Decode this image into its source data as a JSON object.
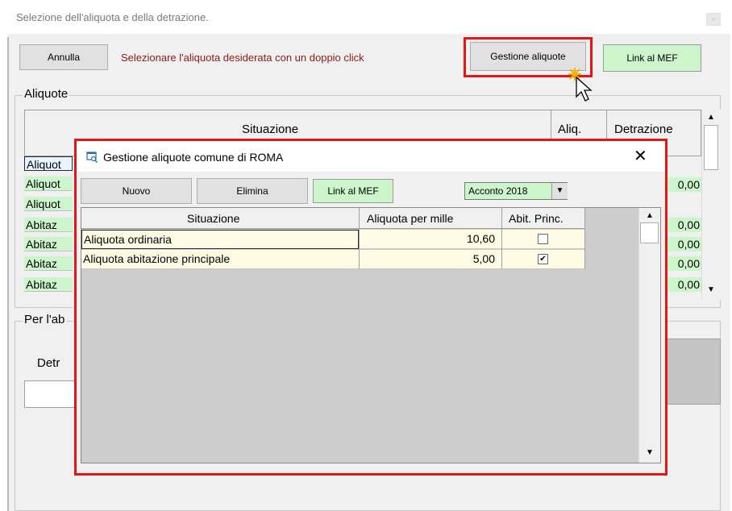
{
  "window": {
    "title": "Selezione dell'aliquota e della detrazione.",
    "close_symbol": "×"
  },
  "toolbar": {
    "annulla_label": "Annulla",
    "instruction": "Selezionare l'aliquota desiderata con un doppio click",
    "gestione_label": "Gestione aliquote",
    "link_mef_label": "Link al MEF"
  },
  "aliquote_section": {
    "label": "Aliquote",
    "columns": [
      "Situazione",
      "Aliq.",
      "Detrazione"
    ],
    "row_labels": [
      "Aliquot",
      "Aliquot",
      "Aliquot",
      "Abitaz",
      "Abitaz",
      "Abitaz",
      "Abitaz"
    ],
    "right_values": [
      "0,00",
      "0,00",
      "0,00",
      "0,00",
      "0,00"
    ]
  },
  "per_section": {
    "label": "Per l'ab",
    "detr_label": "Detr"
  },
  "dialog": {
    "title": "Gestione aliquote comune di ROMA",
    "close_symbol": "✕",
    "buttons": {
      "nuovo": "Nuovo",
      "elimina": "Elimina",
      "link_mef": "Link al MEF"
    },
    "period_select": "Acconto 2018",
    "columns": [
      "Situazione",
      "Aliquota per mille",
      "Abit. Princ."
    ],
    "rows": [
      {
        "situazione": "Aliquota ordinaria",
        "aliquota": "10,60",
        "abit_princ": false
      },
      {
        "situazione": "Aliquota abitazione principale",
        "aliquota": "5,00",
        "abit_princ": true
      }
    ],
    "checkmark": "✔"
  },
  "icons": {
    "dialog_icon": "magnifier-window-icon",
    "cursor": "mouse-pointer-icon"
  },
  "colors": {
    "highlight_red": "#e21818",
    "green_bg": "#ccf5cc",
    "instruction_red": "#8b1a1a",
    "row_yellow": "#fffbe5"
  }
}
